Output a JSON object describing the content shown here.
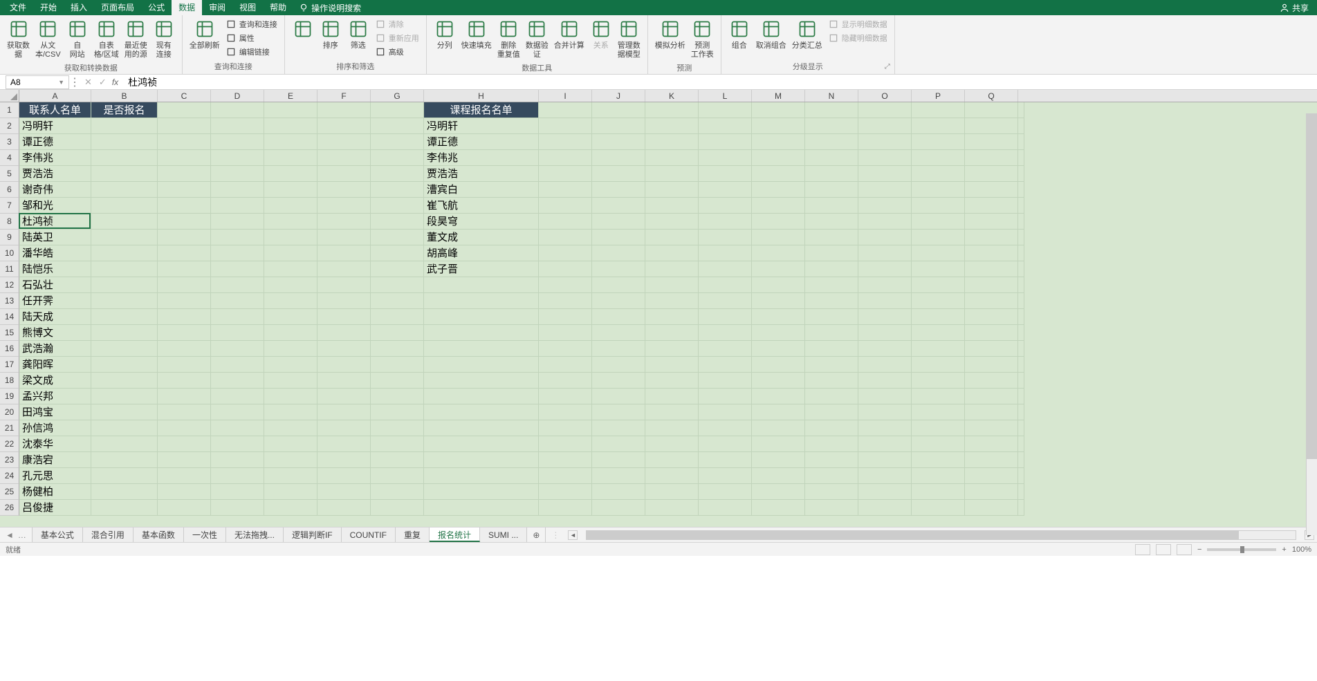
{
  "menu": {
    "items": [
      "文件",
      "开始",
      "插入",
      "页面布局",
      "公式",
      "数据",
      "审阅",
      "视图",
      "帮助"
    ],
    "active_index": 5,
    "tell_me": "操作说明搜索",
    "share": "共享"
  },
  "ribbon": {
    "groups": [
      {
        "label": "获取和转换数据",
        "buttons": [
          {
            "label": "获取数\n据"
          },
          {
            "label": "从文\n本/CSV"
          },
          {
            "label": "自\n网站"
          },
          {
            "label": "自表\n格/区域"
          },
          {
            "label": "最近使\n用的源"
          },
          {
            "label": "现有\n连接"
          }
        ]
      },
      {
        "label": "查询和连接",
        "buttons": [
          {
            "label": "全部刷新"
          }
        ],
        "small": [
          {
            "label": "查询和连接"
          },
          {
            "label": "属性"
          },
          {
            "label": "编辑链接"
          }
        ]
      },
      {
        "label": "排序和筛选",
        "buttons": [
          {
            "label": ""
          },
          {
            "label": "排序"
          },
          {
            "label": "筛选"
          }
        ],
        "small": [
          {
            "label": "清除",
            "disabled": true
          },
          {
            "label": "重新应用",
            "disabled": true
          },
          {
            "label": "高级"
          }
        ]
      },
      {
        "label": "数据工具",
        "buttons": [
          {
            "label": "分列"
          },
          {
            "label": "快速填充"
          },
          {
            "label": "删除\n重复值"
          },
          {
            "label": "数据验\n证"
          },
          {
            "label": "合并计算"
          },
          {
            "label": "关系",
            "disabled": true
          },
          {
            "label": "管理数\n据模型"
          }
        ]
      },
      {
        "label": "预测",
        "buttons": [
          {
            "label": "模拟分析"
          },
          {
            "label": "预测\n工作表"
          }
        ]
      },
      {
        "label": "分级显示",
        "buttons": [
          {
            "label": "组合"
          },
          {
            "label": "取消组合"
          },
          {
            "label": "分类汇总"
          }
        ],
        "small": [
          {
            "label": "显示明细数据",
            "disabled": true
          },
          {
            "label": "隐藏明细数据",
            "disabled": true
          }
        ],
        "launcher": true
      }
    ]
  },
  "namebox": "A8",
  "formula": "杜鸿祯",
  "columns": [
    "A",
    "B",
    "C",
    "D",
    "E",
    "F",
    "G",
    "H",
    "I",
    "J",
    "K",
    "L",
    "M",
    "N",
    "O",
    "P",
    "Q"
  ],
  "row_count": 26,
  "headers": {
    "A1": "联系人名单",
    "B1": "是否报名",
    "H1": "课程报名名单"
  },
  "colA": [
    "冯明轩",
    "谭正德",
    "李伟兆",
    "贾浩浩",
    "谢奇伟",
    "邹和光",
    "杜鸿祯",
    "陆英卫",
    "潘华皓",
    "陆恺乐",
    "石弘壮",
    "任开霁",
    "陆天成",
    "熊博文",
    "武浩瀚",
    "龚阳晖",
    "梁文成",
    "孟兴邦",
    "田鸿宝",
    "孙信鸿",
    "沈泰华",
    "康浩宕",
    "孔元思",
    "杨健柏",
    "吕俊捷"
  ],
  "colH": [
    "冯明轩",
    "谭正德",
    "李伟兆",
    "贾浩浩",
    "漕宾白",
    "崔飞航",
    "段昊穹",
    "董文成",
    "胡高峰",
    "武子晋"
  ],
  "tabs": {
    "nav": [
      "◄",
      "…"
    ],
    "items": [
      "基本公式",
      "混合引用",
      "基本函数",
      "一次性",
      "无法拖拽...",
      "逻辑判断IF",
      "COUNTIF",
      "重复",
      "报名统计",
      "SUMI ..."
    ],
    "active_index": 8
  },
  "status": {
    "ready": "就绪",
    "zoom": "100%"
  }
}
